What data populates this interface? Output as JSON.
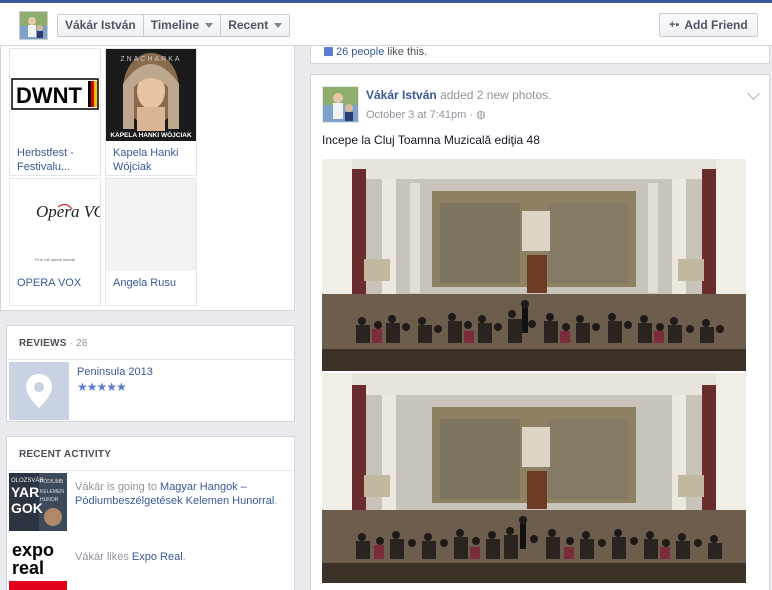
{
  "header": {
    "profile_name": "Vákár István",
    "timeline_label": "Timeline",
    "recent_label": "Recent",
    "add_friend_label": "Add Friend"
  },
  "likes": {
    "items": [
      {
        "name": "Herbstfest - Festivalu...",
        "logo_text": "DWNT"
      },
      {
        "name": "Kapela Hanki Wójciak",
        "logo_text": "KAPELA HANKI WÓJCIAK",
        "banner_text": "ZNACHARKA"
      },
      {
        "name": "OPERA VOX",
        "logo_text": "Opera VOX",
        "tagline": "Firm mit oprere liderali"
      },
      {
        "name": "Angela Rusu"
      }
    ]
  },
  "reviews": {
    "title": "REVIEWS",
    "count": "· 28",
    "items": [
      {
        "name": "Peninsula 2013",
        "rating": 5,
        "stars": "★★★★★"
      }
    ]
  },
  "activity": {
    "title": "RECENT ACTIVITY",
    "items": [
      {
        "actor": "Vákár",
        "verb": "is going to",
        "target": "Magyar Hangok – Pódiumbeszélgetések Kelemen Hunorral",
        "end": ".",
        "thumb_text": [
          "OLOZSVÁR",
          "YAR",
          "GOK",
          "PÓDIUMB",
          "KELEMEN",
          "HUNOR"
        ]
      },
      {
        "actor": "Vákár",
        "verb": "likes",
        "target": "Expo Real",
        "end": ".",
        "thumb_text": [
          "expo",
          "real"
        ]
      }
    ]
  },
  "post_feed": {
    "prev_likes_count": "26 people",
    "prev_likes_suffix": "like this.",
    "post": {
      "author": "Vákár István",
      "action": "added 2 new photos.",
      "timestamp": "October 3 at 7:41pm",
      "separator": "·",
      "text": "Incepe la Cluj Toamna Muzicală ediţia 48"
    }
  },
  "colors": {
    "brand": "#3b5998",
    "link": "#3b5998",
    "star": "#5b7bd5",
    "background": "#e9ebee"
  }
}
